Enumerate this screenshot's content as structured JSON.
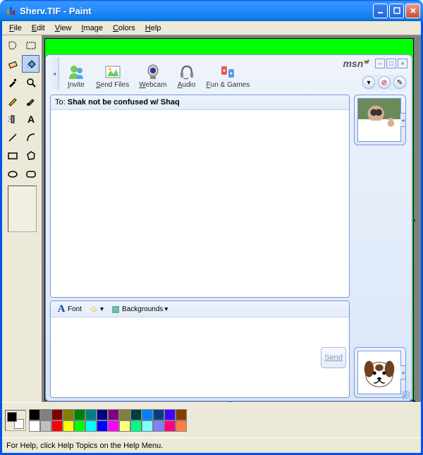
{
  "window": {
    "title": "Sherv.TIF - Paint",
    "min_label": "_",
    "max_label": "□",
    "close_label": "×"
  },
  "menu": {
    "file": "File",
    "file_u": "F",
    "edit": "Edit",
    "edit_u": "E",
    "view": "View",
    "view_u": "V",
    "image": "Image",
    "image_u": "I",
    "colors": "Colors",
    "colors_u": "C",
    "help": "Help",
    "help_u": "H"
  },
  "tools": [
    "free-select",
    "rect-select",
    "eraser",
    "fill",
    "picker",
    "magnifier",
    "pencil",
    "brush",
    "airbrush",
    "text",
    "line",
    "curve",
    "rectangle",
    "polygon",
    "ellipse",
    "rounded-rect"
  ],
  "active_tool": "fill",
  "palette": {
    "row1": [
      "#000000",
      "#808080",
      "#800000",
      "#808000",
      "#008000",
      "#008080",
      "#000080",
      "#800080",
      "#808040",
      "#004040",
      "#0080ff",
      "#004080",
      "#4000ff",
      "#804000"
    ],
    "row2": [
      "#ffffff",
      "#c0c0c0",
      "#ff0000",
      "#ffff00",
      "#00ff00",
      "#00ffff",
      "#0000ff",
      "#ff00ff",
      "#ffff80",
      "#00ff80",
      "#80ffff",
      "#8080ff",
      "#ff0080",
      "#ff8040"
    ]
  },
  "status": "For Help, click Help Topics on the Help Menu.",
  "msn": {
    "handle_glyph": "◂",
    "toolbar": [
      {
        "label": "Invite",
        "underline": "I",
        "icon": "buddy"
      },
      {
        "label": "Send Files",
        "underline": "S",
        "icon": "picture"
      },
      {
        "label": "Webcam",
        "underline": "W",
        "icon": "webcam"
      },
      {
        "label": "Audio",
        "underline": "A",
        "icon": "headset"
      },
      {
        "label": "Fun & Games",
        "underline": "F",
        "icon": "games"
      }
    ],
    "logo": "msn",
    "circ": {
      "down": "▾",
      "block": "⊘",
      "wand": "✎"
    },
    "win": {
      "min": "–",
      "max": "□",
      "close": "×"
    },
    "to_label": "To:",
    "to_name": "Shak not be confused w/ Shaq",
    "format": {
      "font_icon": "A",
      "font_label": "Font",
      "emoticon": "☺",
      "dd": "▾",
      "bg_icon": "▧",
      "bg_label": "Backgrounds",
      "bg_dd": "▾"
    },
    "send_label": "Send",
    "avatar_arrow": "◂"
  }
}
